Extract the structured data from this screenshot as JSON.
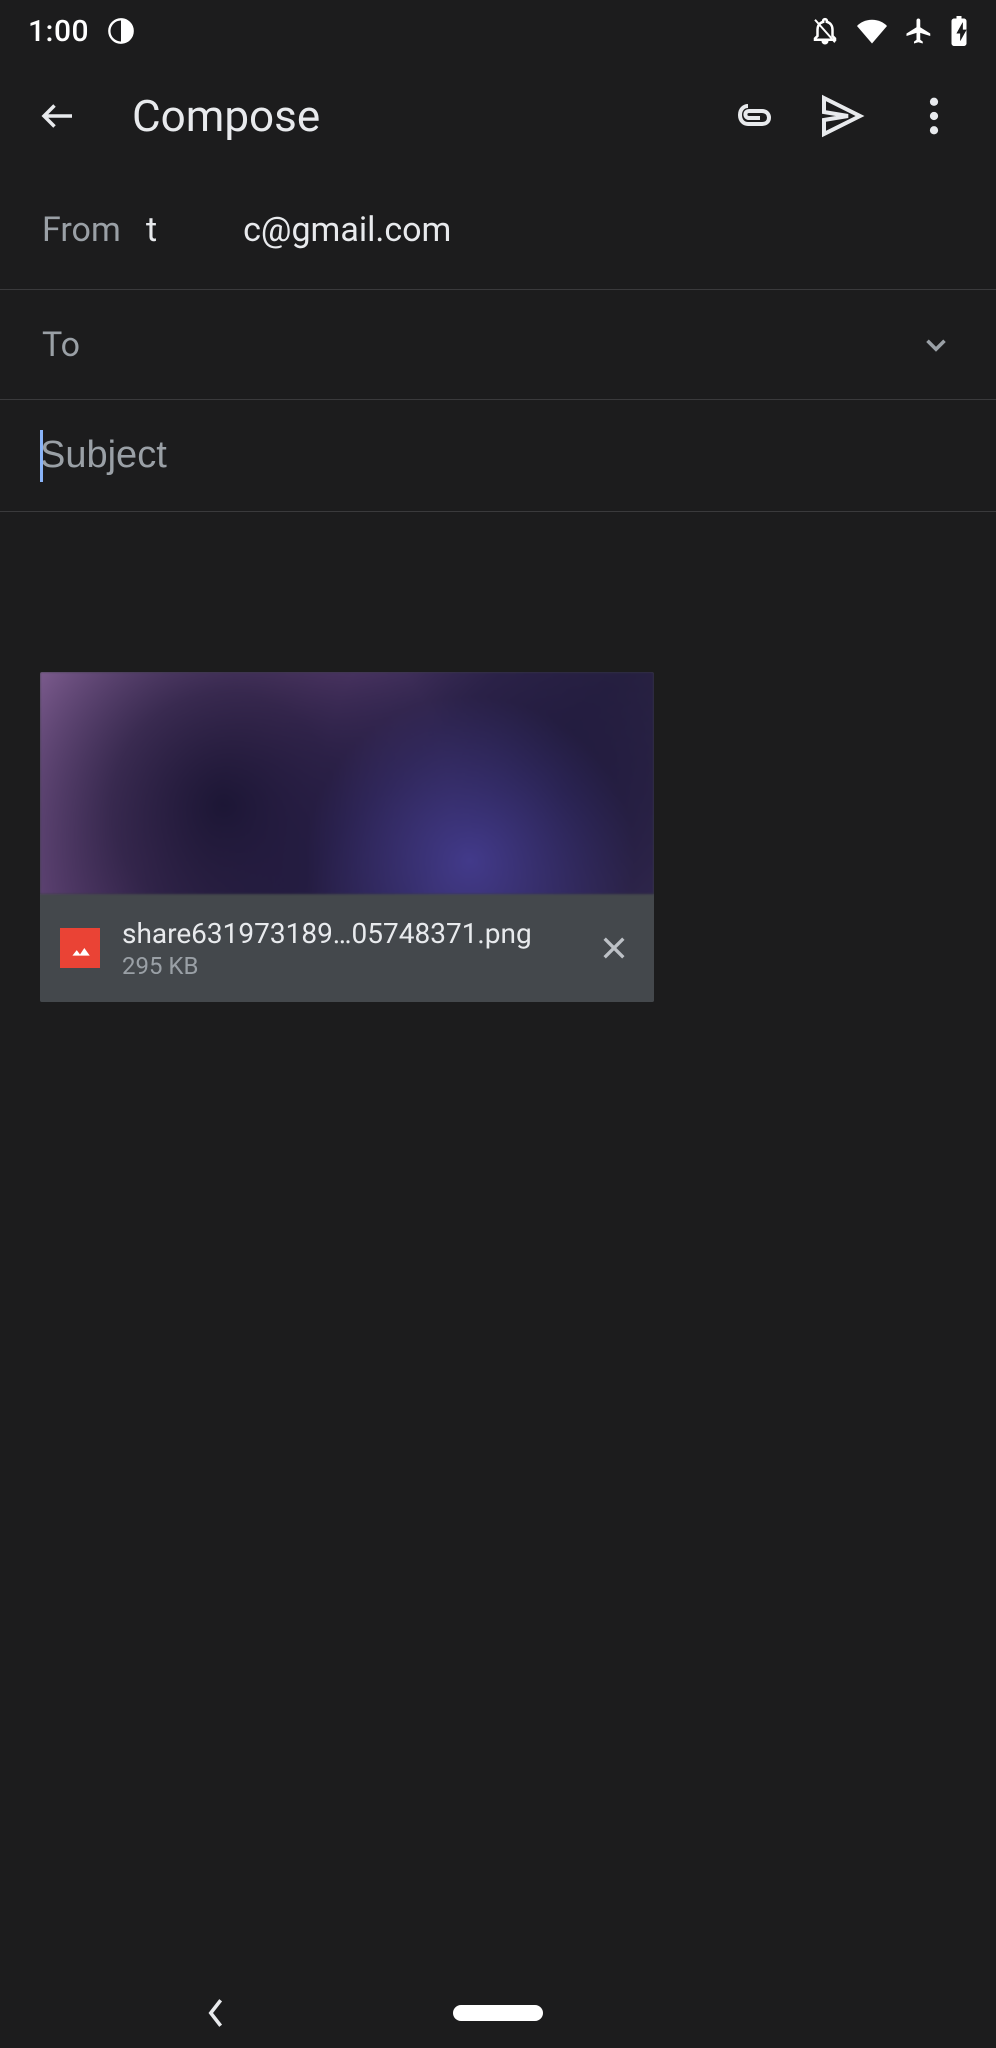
{
  "status": {
    "time": "1:00"
  },
  "header": {
    "title": "Compose"
  },
  "from": {
    "label": "From",
    "email_left": "t",
    "email_right": "c@gmail.com"
  },
  "to": {
    "label": "To"
  },
  "subject": {
    "placeholder": "Subject",
    "value": ""
  },
  "attachment": {
    "filename": "share631973189…05748371.png",
    "size": "295 KB"
  }
}
